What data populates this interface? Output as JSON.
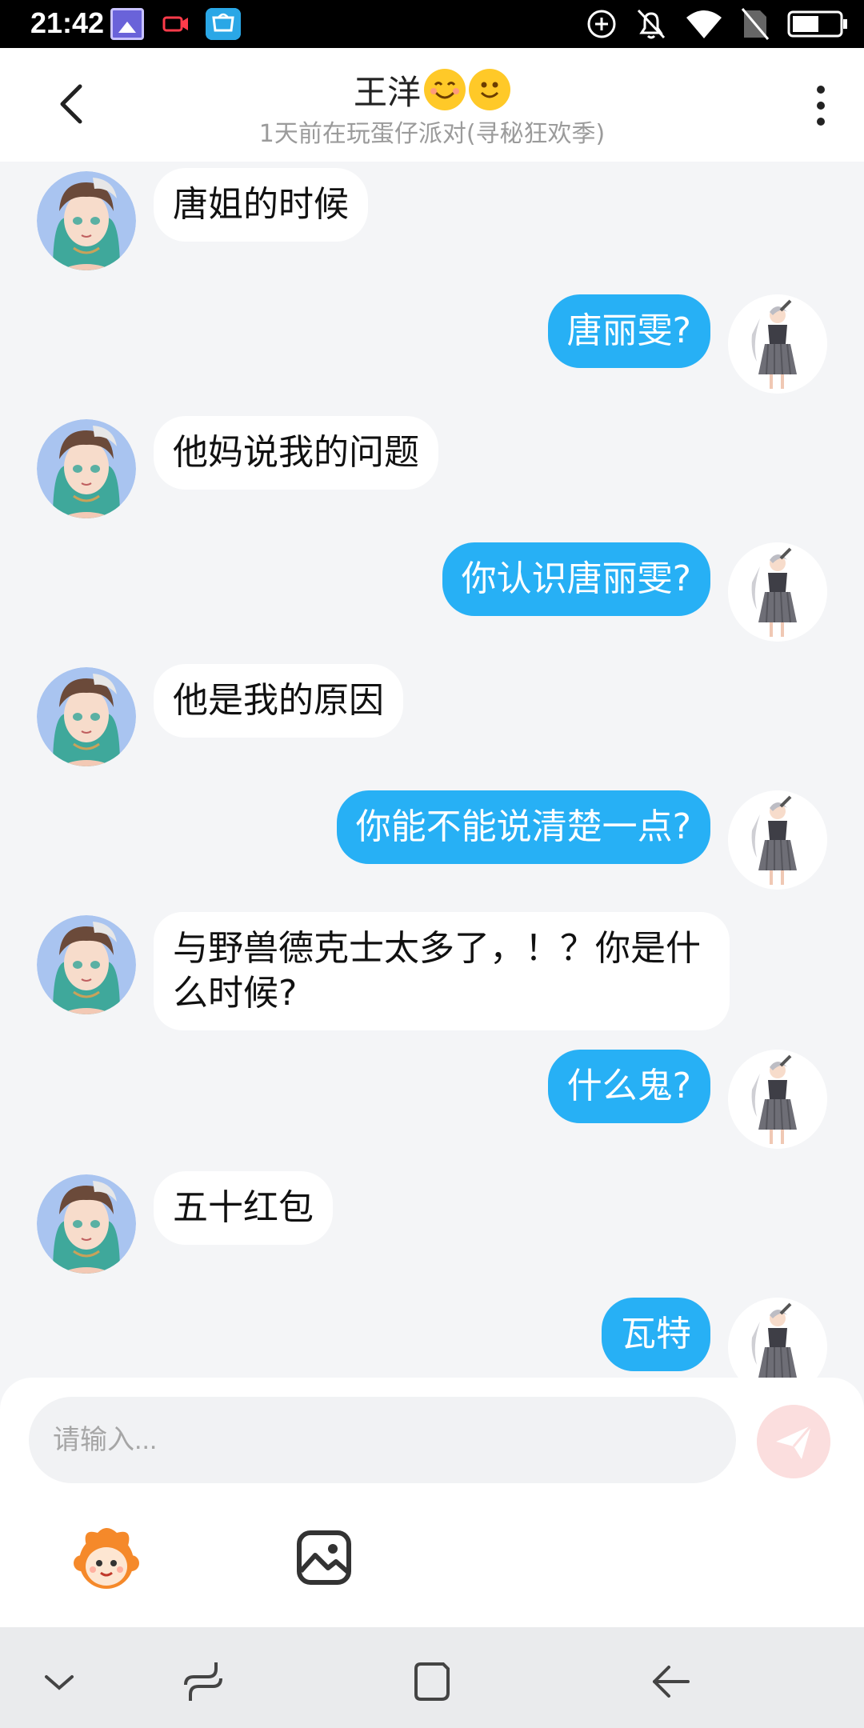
{
  "status_bar": {
    "time": "21:42",
    "icons": [
      "gallery-icon",
      "screen-record-icon",
      "koobee-store-icon",
      "sync-icon",
      "bell-off-icon",
      "wifi-icon",
      "no-sim-icon",
      "battery-icon"
    ]
  },
  "header": {
    "title": "王洋",
    "title_emojis": [
      "smiling-emoji-icon",
      "smiling-emoji-icon"
    ],
    "subtitle": "1天前在玩蛋仔派对(寻秘狂欢季)"
  },
  "messages": [
    {
      "side": "in",
      "text": "唐姐的时候"
    },
    {
      "side": "out",
      "text": "唐丽雯?"
    },
    {
      "side": "in",
      "text": "他妈说我的问题"
    },
    {
      "side": "out",
      "text": "你认识唐丽雯?"
    },
    {
      "side": "in",
      "text": "他是我的原因"
    },
    {
      "side": "out",
      "text": "你能不能说清楚一点?"
    },
    {
      "side": "in",
      "text": "与野兽德克士太多了，！？你是什么时候?"
    },
    {
      "side": "out",
      "text": "什么鬼?"
    },
    {
      "side": "in",
      "text": "五十红包"
    },
    {
      "side": "out",
      "text": "瓦特"
    }
  ],
  "composer": {
    "placeholder": "请输入..."
  },
  "colors": {
    "accent": "#27b0f5",
    "send_disabled": "#fbdede",
    "background": "#f4f5f7"
  }
}
